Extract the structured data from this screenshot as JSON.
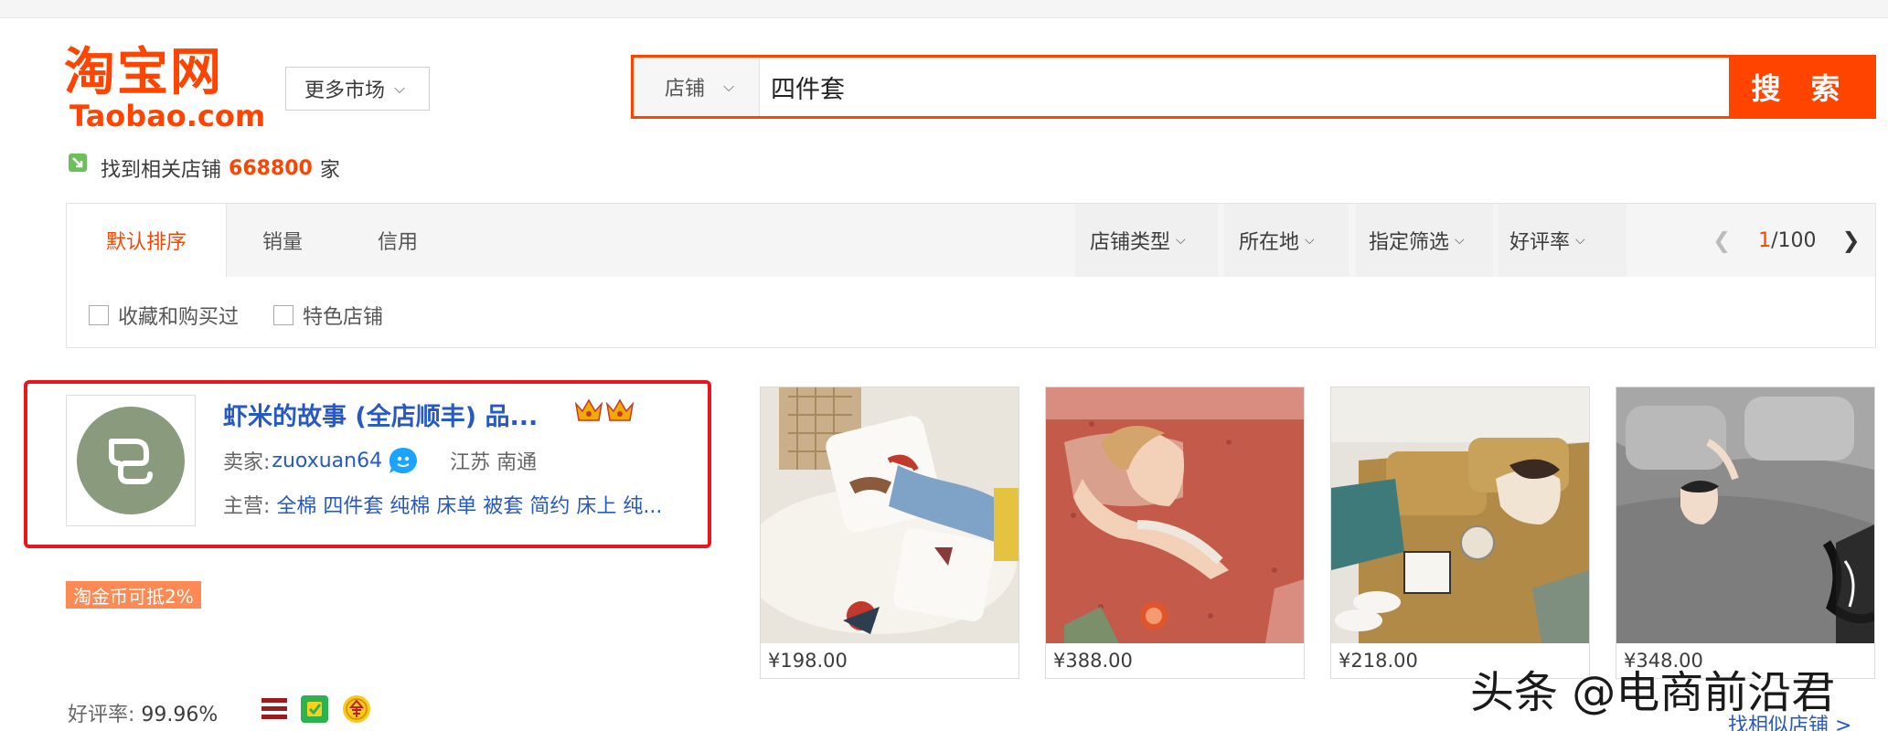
{
  "logo": {
    "cn": "淘宝网",
    "en": "Taobao.com"
  },
  "more_market": {
    "label": "更多市场"
  },
  "search": {
    "type": "店铺",
    "value": "四件套",
    "button": "搜 索"
  },
  "result": {
    "prefix": "找到相关店铺",
    "count": "668800",
    "suffix": "家"
  },
  "sort": {
    "tabs": [
      "默认排序",
      "销量",
      "信用"
    ],
    "dropdowns": [
      "店铺类型",
      "所在地",
      "指定筛选",
      "好评率"
    ],
    "pager": {
      "current": "1",
      "total": "/100"
    }
  },
  "filters": [
    "收藏和购买过",
    "特色店铺"
  ],
  "shop": {
    "name": "虾米的故事 (全店顺丰) 品...",
    "seller_label": "卖家:",
    "seller_nick": "zuoxuan64",
    "location": "江苏 南通",
    "main_label": "主营:",
    "main_items": "全棉 四件套 纯棉 床单 被套 简约 床上 纯...",
    "coin_badge": "淘金币可抵2%",
    "rating_label": "好评率:",
    "rating_value": "99.96%"
  },
  "products": [
    {
      "price": "¥198.00"
    },
    {
      "price": "¥388.00"
    },
    {
      "price": "¥218.00"
    },
    {
      "price": "¥348.00"
    }
  ],
  "similar_link": "找相似店铺 >",
  "watermark": "头条 @电商前沿君",
  "colors": {
    "accent": "#ff4400",
    "link": "#2659c4",
    "highlight_border": "#e8171e"
  }
}
